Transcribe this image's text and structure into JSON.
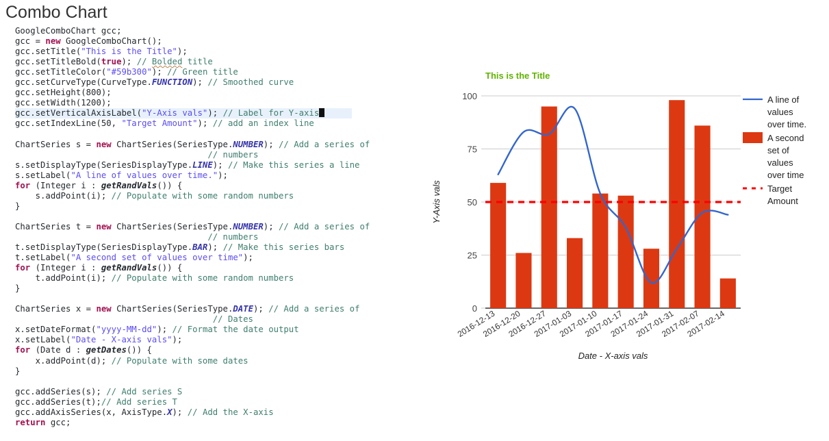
{
  "page_title": "Combo Chart",
  "code": {
    "lines": [
      [
        {
          "t": "GoogleComboChart ",
          "c": "tok-type"
        },
        {
          "t": "gcc;",
          "c": "tok-ident"
        }
      ],
      [
        {
          "t": "gcc = ",
          "c": "tok-ident"
        },
        {
          "t": "new",
          "c": "tok-kw"
        },
        {
          "t": " GoogleComboChart();",
          "c": "tok-type"
        }
      ],
      [
        {
          "t": "gcc.setTitle(",
          "c": "tok-ident"
        },
        {
          "t": "\"This is the Title\"",
          "c": "tok-str"
        },
        {
          "t": ");",
          "c": "tok-ident"
        }
      ],
      [
        {
          "t": "gcc.setTitleBold(",
          "c": "tok-ident"
        },
        {
          "t": "true",
          "c": "tok-kw"
        },
        {
          "t": "); ",
          "c": "tok-ident"
        },
        {
          "t": "// ",
          "c": "tok-com"
        },
        {
          "t": "Bolded",
          "c": "tok-com squig"
        },
        {
          "t": " title",
          "c": "tok-com"
        }
      ],
      [
        {
          "t": "gcc.setTitleColor(",
          "c": "tok-ident"
        },
        {
          "t": "\"#59b300\"",
          "c": "tok-str"
        },
        {
          "t": "); ",
          "c": "tok-ident"
        },
        {
          "t": "// Green title",
          "c": "tok-com"
        }
      ],
      [
        {
          "t": "gcc.setCurveType(CurveType.",
          "c": "tok-ident"
        },
        {
          "t": "FUNCTION",
          "c": "tok-enum"
        },
        {
          "t": "); ",
          "c": "tok-ident"
        },
        {
          "t": "// Smoothed curve",
          "c": "tok-com"
        }
      ],
      [
        {
          "t": "gcc.setHeight(800);",
          "c": "tok-ident"
        }
      ],
      [
        {
          "t": "gcc.setWidth(1200);",
          "c": "tok-ident"
        }
      ],
      [
        {
          "t": "gcc.setVerticalAxisLabel(",
          "c": "tok-ident"
        },
        {
          "t": "\"Y-Axis vals\"",
          "c": "tok-str"
        },
        {
          "t": "); ",
          "c": "tok-ident"
        },
        {
          "t": "// Label for Y-axis",
          "c": "tok-com"
        },
        {
          "t": "CARET",
          "c": "caret"
        }
      ],
      [
        {
          "t": "gcc.setIndexLine(50, ",
          "c": "tok-ident"
        },
        {
          "t": "\"Target Amount\"",
          "c": "tok-str"
        },
        {
          "t": "); ",
          "c": "tok-ident"
        },
        {
          "t": "// add an index line",
          "c": "tok-com"
        }
      ],
      [
        {
          "t": " ",
          "c": "tok-ident"
        }
      ],
      [
        {
          "t": "ChartSeries ",
          "c": "tok-type"
        },
        {
          "t": "s = ",
          "c": "tok-ident"
        },
        {
          "t": "new",
          "c": "tok-kw"
        },
        {
          "t": " ChartSeries(SeriesType.",
          "c": "tok-type"
        },
        {
          "t": "NUMBER",
          "c": "tok-enum"
        },
        {
          "t": "); ",
          "c": "tok-ident"
        },
        {
          "t": "// Add a series of",
          "c": "tok-com"
        }
      ],
      [
        {
          "t": "                                      ",
          "c": "tok-ident"
        },
        {
          "t": "// numbers",
          "c": "tok-com"
        }
      ],
      [
        {
          "t": "s.setDisplayType(SeriesDisplayType.",
          "c": "tok-ident"
        },
        {
          "t": "LINE",
          "c": "tok-enum"
        },
        {
          "t": "); ",
          "c": "tok-ident"
        },
        {
          "t": "// Make this series a line",
          "c": "tok-com"
        }
      ],
      [
        {
          "t": "s.setLabel(",
          "c": "tok-ident"
        },
        {
          "t": "\"A line of values over time.\"",
          "c": "tok-str"
        },
        {
          "t": ");",
          "c": "tok-ident"
        }
      ],
      [
        {
          "t": "for",
          "c": "tok-kw"
        },
        {
          "t": " (Integer i : ",
          "c": "tok-ident"
        },
        {
          "t": "getRandVals",
          "c": "tok-fn"
        },
        {
          "t": "()) {",
          "c": "tok-ident"
        }
      ],
      [
        {
          "t": "    s.addPoint(i); ",
          "c": "tok-ident"
        },
        {
          "t": "// Populate with some random numbers",
          "c": "tok-com"
        }
      ],
      [
        {
          "t": "}",
          "c": "tok-ident"
        }
      ],
      [
        {
          "t": " ",
          "c": "tok-ident"
        }
      ],
      [
        {
          "t": "ChartSeries ",
          "c": "tok-type"
        },
        {
          "t": "t = ",
          "c": "tok-ident"
        },
        {
          "t": "new",
          "c": "tok-kw"
        },
        {
          "t": " ChartSeries(SeriesType.",
          "c": "tok-type"
        },
        {
          "t": "NUMBER",
          "c": "tok-enum"
        },
        {
          "t": "); ",
          "c": "tok-ident"
        },
        {
          "t": "// Add a series of",
          "c": "tok-com"
        }
      ],
      [
        {
          "t": "                                      ",
          "c": "tok-ident"
        },
        {
          "t": "// numbers",
          "c": "tok-com"
        }
      ],
      [
        {
          "t": "t.setDisplayType(SeriesDisplayType.",
          "c": "tok-ident"
        },
        {
          "t": "BAR",
          "c": "tok-enum"
        },
        {
          "t": "); ",
          "c": "tok-ident"
        },
        {
          "t": "// Make this series bars",
          "c": "tok-com"
        }
      ],
      [
        {
          "t": "t.setLabel(",
          "c": "tok-ident"
        },
        {
          "t": "\"A second set of values over time\"",
          "c": "tok-str"
        },
        {
          "t": ");",
          "c": "tok-ident"
        }
      ],
      [
        {
          "t": "for",
          "c": "tok-kw"
        },
        {
          "t": " (Integer i : ",
          "c": "tok-ident"
        },
        {
          "t": "getRandVals",
          "c": "tok-fn"
        },
        {
          "t": "()) {",
          "c": "tok-ident"
        }
      ],
      [
        {
          "t": "    t.addPoint(i); ",
          "c": "tok-ident"
        },
        {
          "t": "// Populate with some random numbers",
          "c": "tok-com"
        }
      ],
      [
        {
          "t": "}",
          "c": "tok-ident"
        }
      ],
      [
        {
          "t": " ",
          "c": "tok-ident"
        }
      ],
      [
        {
          "t": "ChartSeries ",
          "c": "tok-type"
        },
        {
          "t": "x = ",
          "c": "tok-ident"
        },
        {
          "t": "new",
          "c": "tok-kw"
        },
        {
          "t": " ChartSeries(SeriesType.",
          "c": "tok-type"
        },
        {
          "t": "DATE",
          "c": "tok-enum"
        },
        {
          "t": "); ",
          "c": "tok-ident"
        },
        {
          "t": "// Add a series of",
          "c": "tok-com"
        }
      ],
      [
        {
          "t": "                                       ",
          "c": "tok-ident"
        },
        {
          "t": "// Dates",
          "c": "tok-com"
        }
      ],
      [
        {
          "t": "x.setDateFormat(",
          "c": "tok-ident"
        },
        {
          "t": "\"yyyy-MM-dd\"",
          "c": "tok-str"
        },
        {
          "t": "); ",
          "c": "tok-ident"
        },
        {
          "t": "// Format the date output",
          "c": "tok-com"
        }
      ],
      [
        {
          "t": "x.setLabel(",
          "c": "tok-ident"
        },
        {
          "t": "\"Date - X-axis vals\"",
          "c": "tok-str"
        },
        {
          "t": ");",
          "c": "tok-ident"
        }
      ],
      [
        {
          "t": "for",
          "c": "tok-kw"
        },
        {
          "t": " (Date d : ",
          "c": "tok-ident"
        },
        {
          "t": "getDates",
          "c": "tok-fn"
        },
        {
          "t": "()) {",
          "c": "tok-ident"
        }
      ],
      [
        {
          "t": "    x.addPoint(d); ",
          "c": "tok-ident"
        },
        {
          "t": "// Populate with some dates",
          "c": "tok-com"
        }
      ],
      [
        {
          "t": "}",
          "c": "tok-ident"
        }
      ],
      [
        {
          "t": " ",
          "c": "tok-ident"
        }
      ],
      [
        {
          "t": "gcc.addSeries(s); ",
          "c": "tok-ident"
        },
        {
          "t": "// Add series S",
          "c": "tok-com"
        }
      ],
      [
        {
          "t": "gcc.addSeries(t);",
          "c": "tok-ident"
        },
        {
          "t": "// Add series T",
          "c": "tok-com"
        }
      ],
      [
        {
          "t": "gcc.addAxisSeries(x, AxisType.",
          "c": "tok-ident"
        },
        {
          "t": "X",
          "c": "tok-enum"
        },
        {
          "t": "); ",
          "c": "tok-ident"
        },
        {
          "t": "// Add the X-axis",
          "c": "tok-com"
        }
      ],
      [
        {
          "t": "return",
          "c": "tok-kw"
        },
        {
          "t": " gcc;",
          "c": "tok-ident"
        }
      ]
    ],
    "highlighted_line_index": 8
  },
  "chart_data": {
    "type": "bar",
    "title": "This is the Title",
    "title_color": "#5fb300",
    "xlabel": "Date - X-axis vals",
    "ylabel": "Y-Axis vals",
    "ylim": [
      0,
      100
    ],
    "yticks": [
      0,
      25,
      50,
      75,
      100
    ],
    "grid": true,
    "legend_position": "right",
    "categories": [
      "2016-12-13",
      "2016-12-20",
      "2016-12-27",
      "2017-01-03",
      "2017-01-10",
      "2017-01-17",
      "2017-01-24",
      "2017-01-31",
      "2017-02-07",
      "2017-02-14"
    ],
    "series": [
      {
        "name": "A second set of values over time",
        "display": "bar",
        "color": "#dc3912",
        "values": [
          59,
          26,
          95,
          33,
          54,
          53,
          28,
          98,
          86,
          14
        ]
      },
      {
        "name": "A line of values over time.",
        "display": "line",
        "curve": "function",
        "color": "#3366cc",
        "values": [
          63,
          83,
          82,
          94,
          54,
          38,
          12,
          28,
          45,
          44
        ]
      }
    ],
    "index_line": {
      "label": "Target Amount",
      "value": 50,
      "color": "#ff0000",
      "style": "dashed"
    },
    "legend_entries": [
      {
        "label": "A line of values over time.",
        "marker": "line",
        "color": "#3366cc"
      },
      {
        "label": "A second set of values over time",
        "marker": "square",
        "color": "#dc3912"
      },
      {
        "label": "Target Amount",
        "marker": "dashed-line",
        "color": "#ff0000"
      }
    ]
  }
}
